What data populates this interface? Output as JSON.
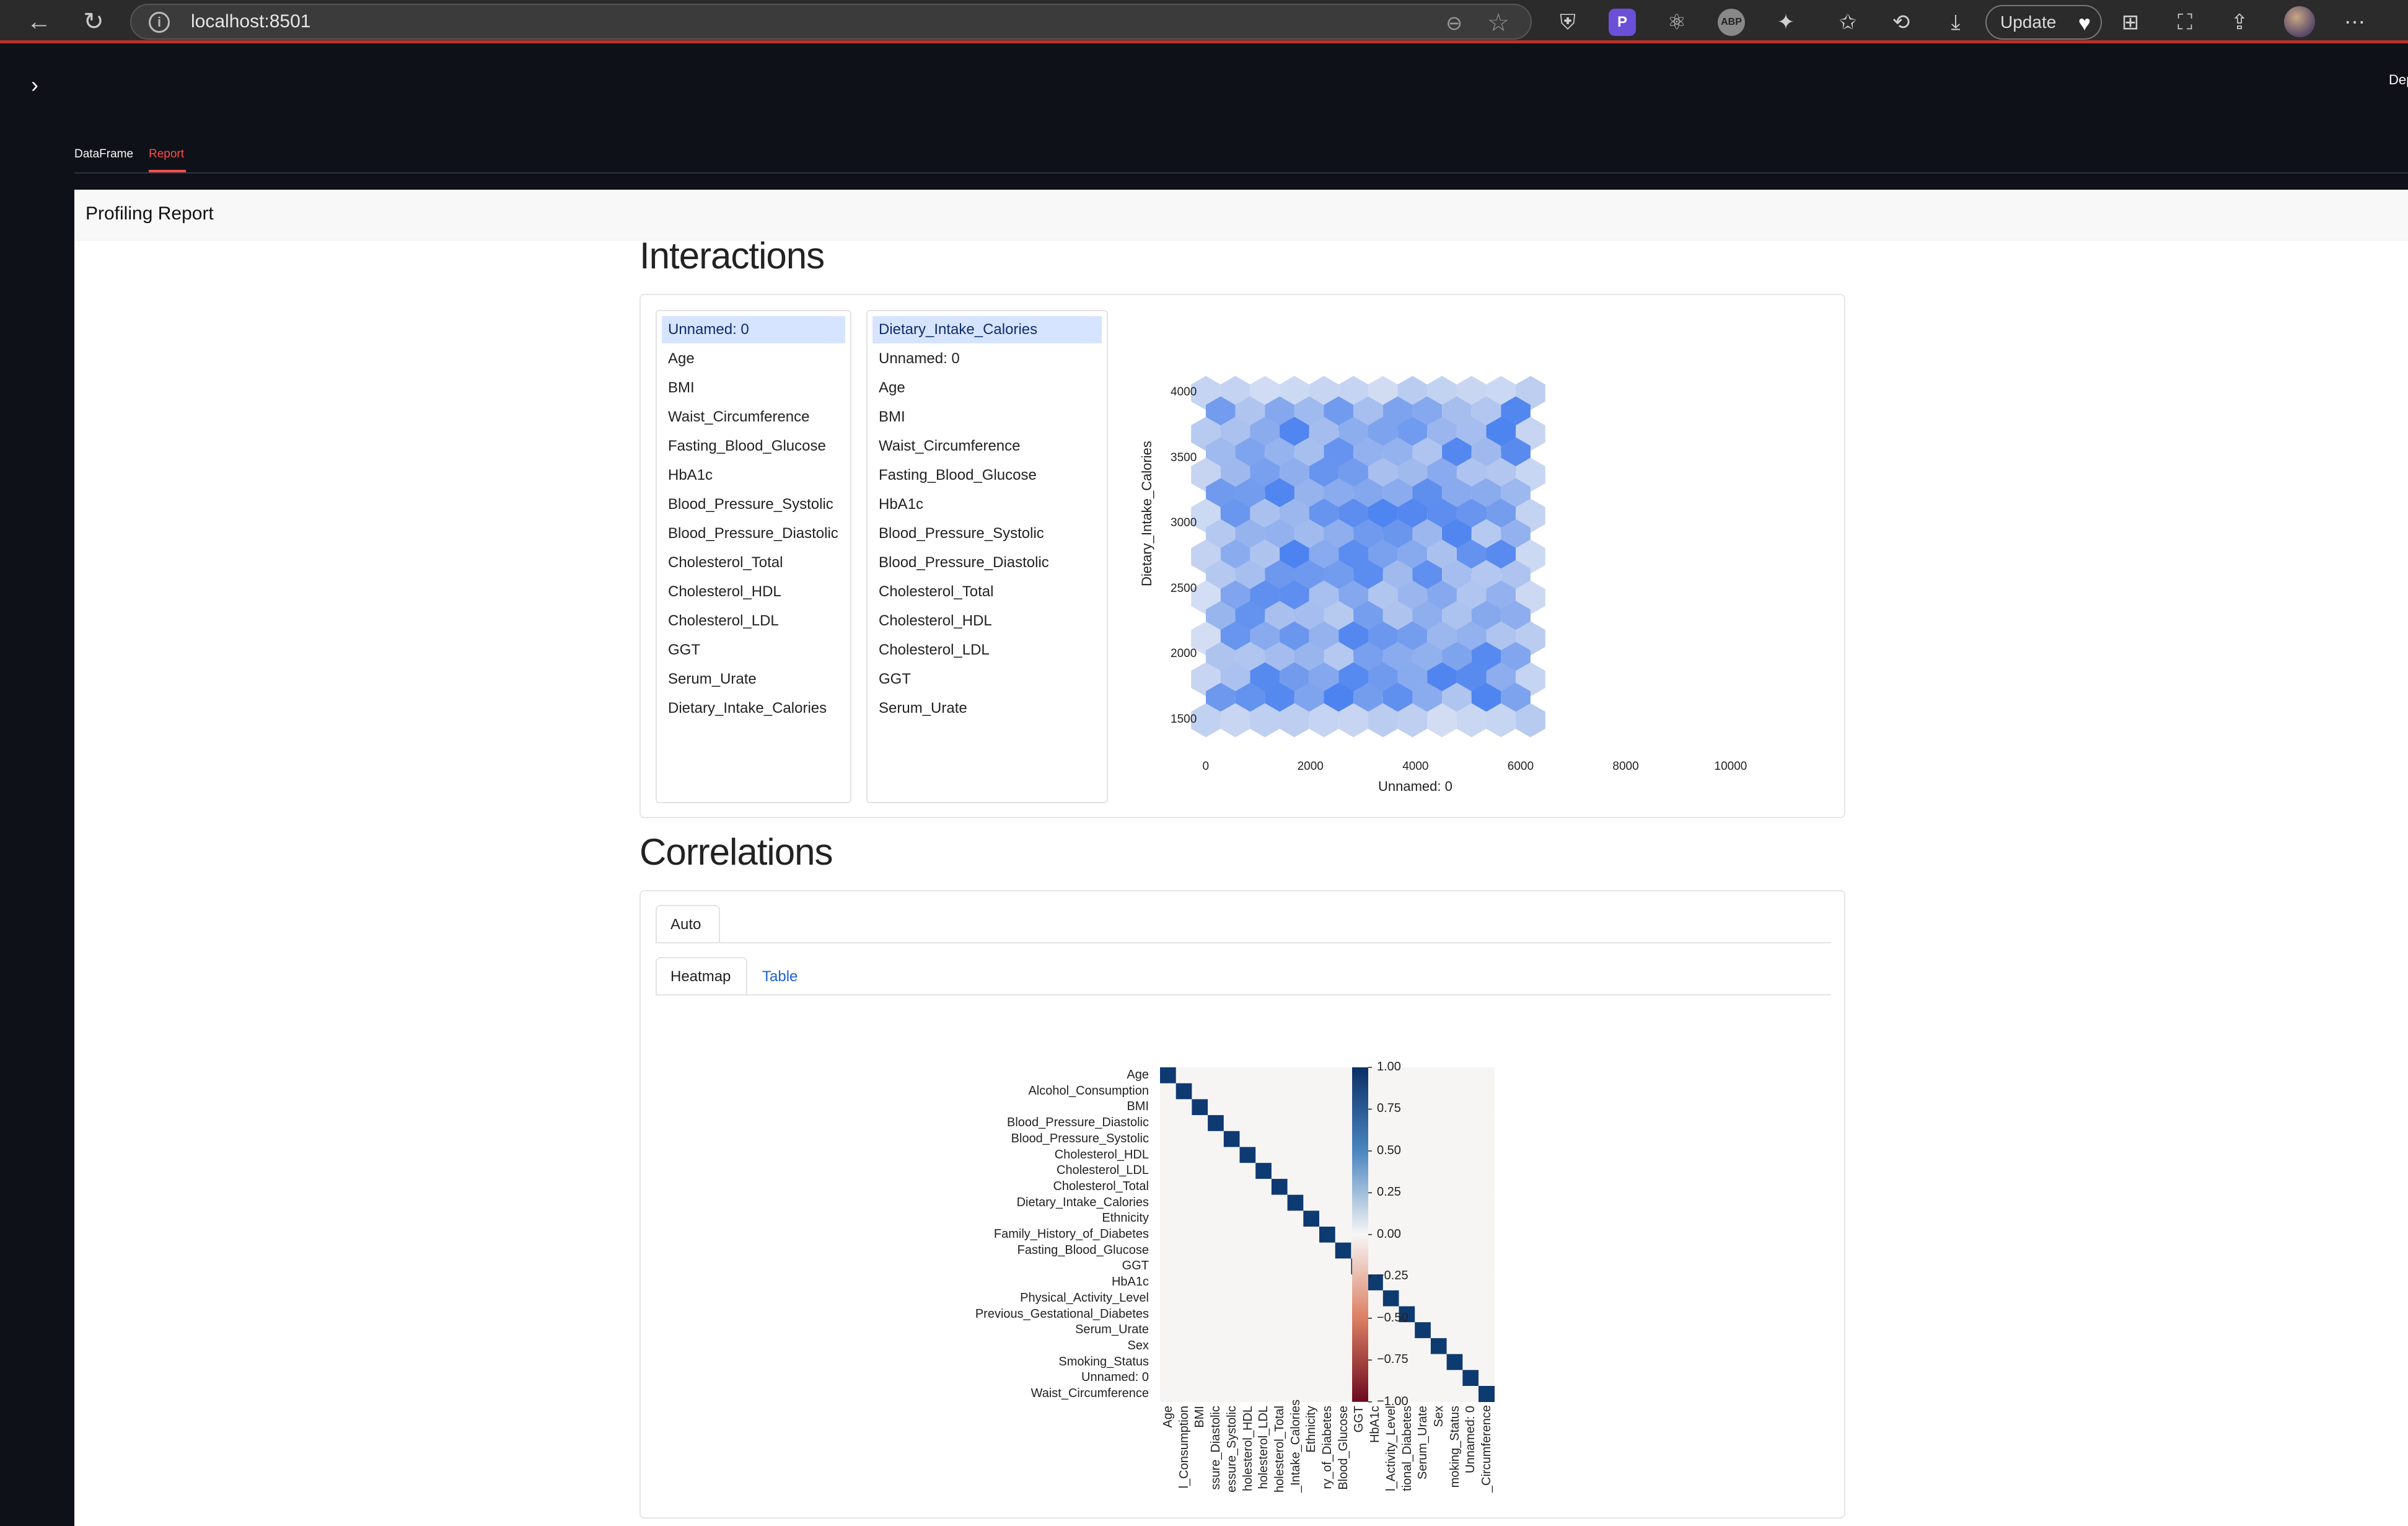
{
  "browser": {
    "url": "localhost:8501",
    "update_label": "Update"
  },
  "app": {
    "deploy_label": "Dep",
    "tabs": [
      {
        "label": "DataFrame",
        "active": false
      },
      {
        "label": "Report",
        "active": true
      }
    ],
    "accent_color": "#ff4b4b"
  },
  "report": {
    "brand": "Profiling Report",
    "interactions": {
      "title": "Interactions",
      "x_options": [
        "Unnamed: 0",
        "Age",
        "BMI",
        "Waist_Circumference",
        "Fasting_Blood_Glucose",
        "HbA1c",
        "Blood_Pressure_Systolic",
        "Blood_Pressure_Diastolic",
        "Cholesterol_Total",
        "Cholesterol_HDL",
        "Cholesterol_LDL",
        "GGT",
        "Serum_Urate",
        "Dietary_Intake_Calories"
      ],
      "x_selected": "Unnamed: 0",
      "y_options": [
        "Dietary_Intake_Calories",
        "Unnamed: 0",
        "Age",
        "BMI",
        "Waist_Circumference",
        "Fasting_Blood_Glucose",
        "HbA1c",
        "Blood_Pressure_Systolic",
        "Blood_Pressure_Diastolic",
        "Cholesterol_Total",
        "Cholesterol_HDL",
        "Cholesterol_LDL",
        "GGT",
        "Serum_Urate"
      ],
      "y_selected": "Dietary_Intake_Calories"
    },
    "correlations": {
      "title": "Correlations",
      "tab_auto": "Auto",
      "tab_heatmap": "Heatmap",
      "tab_table": "Table"
    }
  },
  "chart_data": [
    {
      "type": "hexbin",
      "xlabel": "Unnamed: 0",
      "ylabel": "Dietary_Intake_Calories",
      "xlim": [
        0,
        10000
      ],
      "ylim": [
        1500,
        4000
      ],
      "x_ticks": [
        "0",
        "2000",
        "4000",
        "6000",
        "8000",
        "10000"
      ],
      "y_ticks": [
        "4000",
        "3500",
        "3000",
        "2500",
        "2000",
        "1500"
      ],
      "color": "#2f6ff0"
    },
    {
      "type": "heatmap",
      "variables": [
        "Age",
        "Alcohol_Consumption",
        "BMI",
        "Blood_Pressure_Diastolic",
        "Blood_Pressure_Systolic",
        "Cholesterol_HDL",
        "Cholesterol_LDL",
        "Cholesterol_Total",
        "Dietary_Intake_Calories",
        "Ethnicity",
        "Family_History_of_Diabetes",
        "Fasting_Blood_Glucose",
        "GGT",
        "HbA1c",
        "Physical_Activity_Level",
        "Previous_Gestational_Diabetes",
        "Serum_Urate",
        "Sex",
        "Smoking_Status",
        "Unnamed: 0",
        "Waist_Circumference"
      ],
      "x_tick_labels": [
        "Age",
        "l_Consumption",
        "BMI",
        "ssure_Diastolic",
        "essure_Systolic",
        "holesterol_HDL",
        "holesterol_LDL",
        "holesterol_Total",
        "_Intake_Calories",
        "Ethnicity",
        "ry_of_Diabetes",
        "Blood_Glucose",
        "GGT",
        "HbA1c",
        "l_Activity_Level",
        "tional_Diabetes",
        "Serum_Urate",
        "Sex",
        "moking_Status",
        "Unnamed: 0",
        "_Circumference"
      ],
      "diagonal_value": 1.0,
      "off_diagonal_value": 0.0,
      "colorbar_ticks": [
        "1.00",
        "0.75",
        "0.50",
        "0.25",
        "0.00",
        "−0.25",
        "−0.50",
        "−0.75",
        "−1.00"
      ],
      "vmin": -1.0,
      "vmax": 1.0
    }
  ]
}
